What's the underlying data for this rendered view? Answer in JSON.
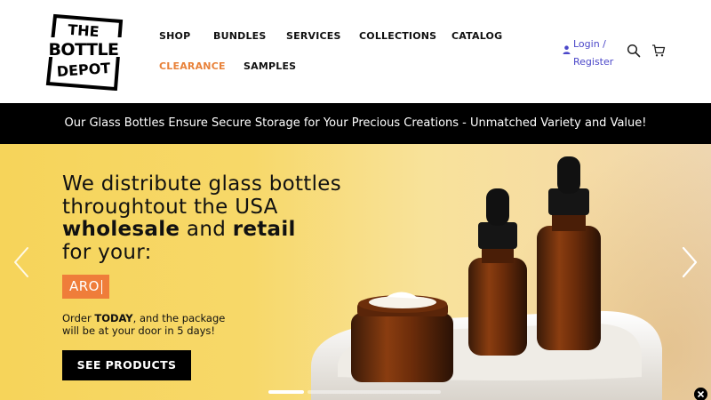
{
  "brand": {
    "logo_lines": [
      "THE",
      "BOTTLE",
      "DEPOT"
    ]
  },
  "nav": {
    "items": [
      {
        "label": "SHOP"
      },
      {
        "label": "BUNDLES"
      },
      {
        "label": "SERVICES"
      },
      {
        "label": "COLLECTIONS"
      },
      {
        "label": "CATALOG"
      },
      {
        "label": "CLEARANCE"
      },
      {
        "label": "SAMPLES"
      }
    ]
  },
  "account": {
    "login_label": "Login /",
    "register_label": "Register"
  },
  "icons": {
    "search": "search-icon",
    "cart": "cart-icon",
    "user": "user-icon"
  },
  "announcement": {
    "text": "Our Glass Bottles Ensure Secure Storage for Your Precious Creations - Unmatched Variety and Value!"
  },
  "hero": {
    "line1": "We distribute glass bottles",
    "line2": "throughtout the USA",
    "line3_bold1": "wholesale",
    "line3_mid": " and ",
    "line3_bold2": "retail",
    "line4": "for your:",
    "typed_word": "ARO",
    "order_pre": "Order ",
    "order_bold": "TODAY",
    "order_post": ", and the package",
    "order_line2": "will be at your door in 5 days!",
    "cta_label": "SEE PRODUCTS"
  },
  "colors": {
    "accent_orange": "#ef7d3a",
    "nav_clearance": "#e8823a",
    "link_blue": "#4b47c9",
    "black": "#000000",
    "hero_yellow": "#f6d45a"
  }
}
